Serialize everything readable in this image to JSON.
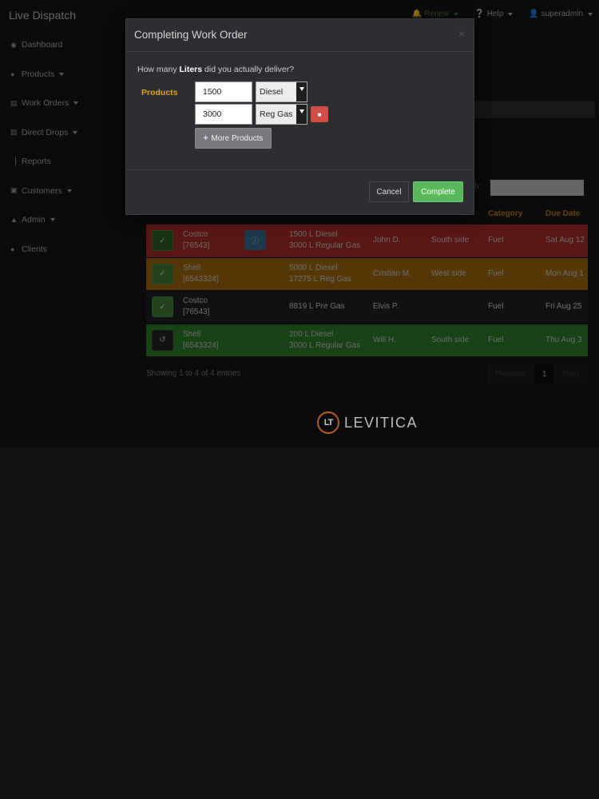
{
  "app": {
    "brand": "Live Dispatch",
    "top_links": [
      {
        "label": "Renew",
        "icon": "bell-icon"
      },
      {
        "label": "Help",
        "icon": "help-circle-icon"
      },
      {
        "label": "superadmin",
        "icon": "user-icon"
      }
    ]
  },
  "sidebar": {
    "items": [
      {
        "label": "Dashboard",
        "icon": "dashboard-icon",
        "dropdown": false
      },
      {
        "label": "Products",
        "icon": "product-icon",
        "dropdown": true
      },
      {
        "label": "Work Orders",
        "icon": "list-icon",
        "dropdown": true
      },
      {
        "label": "Direct Drops",
        "icon": "truck-icon",
        "dropdown": true
      },
      {
        "label": "Reports",
        "icon": "bar-chart-icon",
        "dropdown": false
      },
      {
        "label": "Customers",
        "icon": "id-card-icon",
        "dropdown": true
      },
      {
        "label": "Admin",
        "icon": "lock-icon",
        "dropdown": true
      },
      {
        "label": "Clients",
        "icon": "users-icon",
        "dropdown": false
      }
    ]
  },
  "table": {
    "search_label": "ch:",
    "headers": {
      "category": "Category",
      "due_date": "Due Date"
    },
    "rows": [
      {
        "color": "red",
        "action": "done",
        "customer": "Costco",
        "customer_id": "[76543]",
        "has_info": true,
        "products": [
          "1500 L Diesel",
          "3000 L Regular Gas"
        ],
        "assigned": "John D.",
        "location": "South side",
        "category": "Fuel",
        "due": "Sat Aug 12"
      },
      {
        "color": "orange",
        "action": "done2",
        "customer": "Shell",
        "customer_id": "[6543324]",
        "has_info": false,
        "products": [
          "5000 L Diesel",
          "17275 L Reg Gas"
        ],
        "assigned": "Cristian M.",
        "location": "West side",
        "category": "Fuel",
        "due": "Mon Aug 1"
      },
      {
        "color": "dark",
        "action": "done2",
        "customer": "Costco",
        "customer_id": "[76543]",
        "has_info": false,
        "products": [
          "8819 L Pre Gas"
        ],
        "assigned": "Elvis P.",
        "location": "",
        "category": "Fuel",
        "due": "Fri Aug 25"
      },
      {
        "color": "green",
        "action": "undo",
        "customer": "Shell",
        "customer_id": "[6543324]",
        "has_info": false,
        "products": [
          "200 L Diesel",
          "3000 L Regular Gas"
        ],
        "assigned": "Will H.",
        "location": "South side",
        "category": "Fuel",
        "due": "Thu Aug 3"
      }
    ],
    "showing": "Showing 1 to 4 of 4 entries",
    "pager": {
      "previous": "Previous",
      "page": "1",
      "next": "Next"
    }
  },
  "logo": {
    "mark": "LT",
    "text": "LEVITICA"
  },
  "modal": {
    "title": "Completing Work Order",
    "close": "×",
    "question_prefix": "How many ",
    "question_unit": "Liters",
    "question_suffix": " did you actually deliver?",
    "products_label": "Products",
    "lines": [
      {
        "quantity": "1500",
        "product": "Diesel"
      },
      {
        "quantity": "3000",
        "product": "Reg Gas"
      }
    ],
    "more_products": "More Products",
    "cancel": "Cancel",
    "complete": "Complete"
  },
  "colors": {
    "accent_label": "#e0a020",
    "complete": "#59b95a",
    "delete": "#d24b45",
    "row_red": "#a02826",
    "row_orange": "#9b6410",
    "row_green": "#2a7a2b"
  }
}
